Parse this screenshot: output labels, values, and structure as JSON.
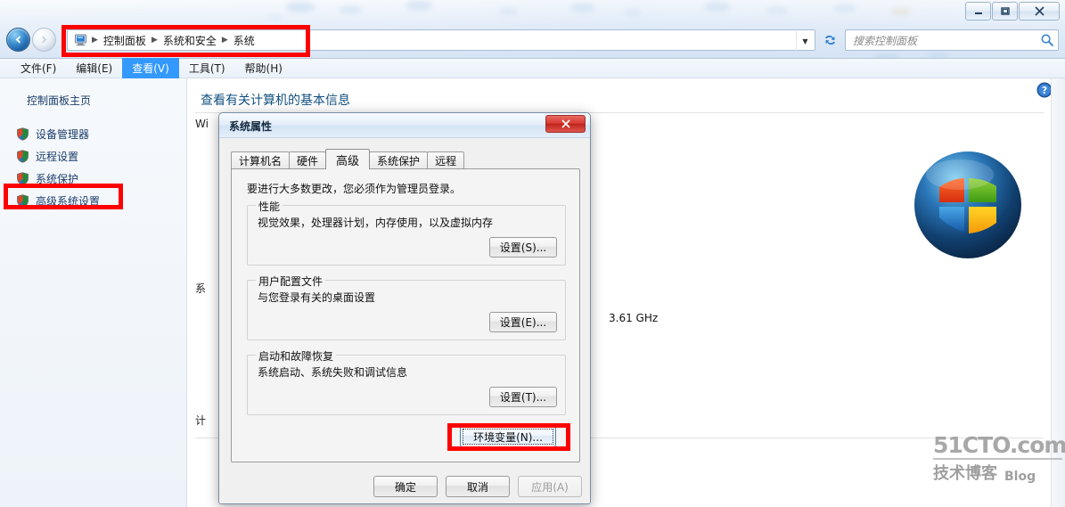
{
  "window": {
    "controls": {
      "minimize": "minimize-icon",
      "maximize": "maximize-icon",
      "close": "close-icon"
    }
  },
  "addressbar": {
    "computer_icon": "computer-icon",
    "crumbs": [
      "控制面板",
      "系统和安全",
      "系统"
    ],
    "separator": "▶",
    "dropdown_icon": "chevron-down-icon",
    "refresh_icon": "refresh-icon"
  },
  "search": {
    "placeholder": "搜索控制面板",
    "icon": "search-icon"
  },
  "menubar": {
    "items": [
      {
        "label": "文件(F)",
        "active": false
      },
      {
        "label": "编辑(E)",
        "active": false
      },
      {
        "label": "查看(V)",
        "active": true
      },
      {
        "label": "工具(T)",
        "active": false
      },
      {
        "label": "帮助(H)",
        "active": false
      }
    ]
  },
  "sidebar": {
    "title": "控制面板主页",
    "items": [
      {
        "label": "设备管理器",
        "icon": "shield-icon"
      },
      {
        "label": "远程设置",
        "icon": "shield-icon"
      },
      {
        "label": "系统保护",
        "icon": "shield-icon"
      },
      {
        "label": "高级系统设置",
        "icon": "shield-icon",
        "highlighted": true
      }
    ]
  },
  "main": {
    "page_title": "查看有关计算机的基本信息",
    "help_icon": "help-icon",
    "occluded_labels": {
      "windows_edition": "Wi",
      "system": "系",
      "computer_name": "计"
    },
    "processor_speed": "3.61 GHz",
    "logo": "windows-logo"
  },
  "watermark": {
    "top": "51CTO.com",
    "bottom_cn": "技术博客",
    "bottom_en": "Blog"
  },
  "dialog": {
    "title": "系统属性",
    "close_label": "✕",
    "tabs": [
      {
        "label": "计算机名",
        "selected": false
      },
      {
        "label": "硬件",
        "selected": false
      },
      {
        "label": "高级",
        "selected": true
      },
      {
        "label": "系统保护",
        "selected": false
      },
      {
        "label": "远程",
        "selected": false
      }
    ],
    "note": "要进行大多数更改，您必须作为管理员登录。",
    "groups": [
      {
        "legend": "性能",
        "description": "视觉效果，处理器计划，内存使用，以及虚拟内存",
        "button": "设置(S)..."
      },
      {
        "legend": "用户配置文件",
        "description": "与您登录有关的桌面设置",
        "button": "设置(E)..."
      },
      {
        "legend": "启动和故障恢复",
        "description": "系统启动、系统失败和调试信息",
        "button": "设置(T)..."
      }
    ],
    "env_button": "环境变量(N)...",
    "footer": {
      "ok": "确定",
      "cancel": "取消",
      "apply": "应用(A)",
      "apply_disabled": true
    }
  },
  "annotations": {
    "color": "#fe0000",
    "boxes": [
      "address-bar",
      "sidebar-advanced-system-settings",
      "environment-variables-button"
    ]
  }
}
